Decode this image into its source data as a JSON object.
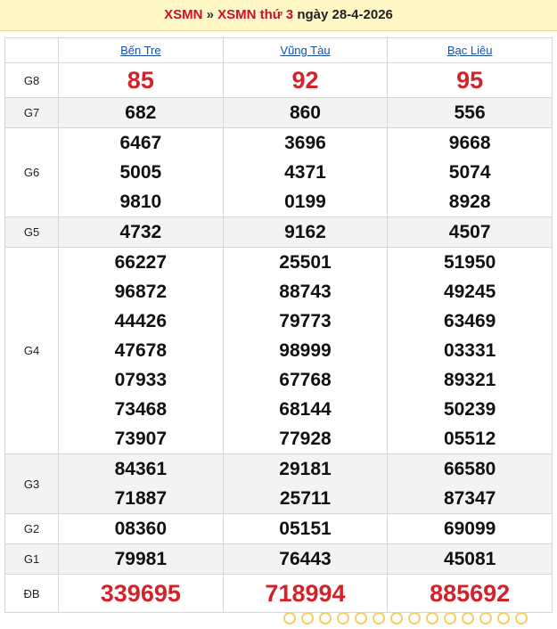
{
  "breadcrumb": {
    "link1": "XSMN",
    "separator": "»",
    "link2": "XSMN thứ 3",
    "date_text": "ngày 28-4-2026"
  },
  "provinces": [
    "Bến Tre",
    "Vũng Tàu",
    "Bạc Liêu"
  ],
  "prizes": [
    {
      "label": "G8",
      "values": [
        [
          "85"
        ],
        [
          "92"
        ],
        [
          "95"
        ]
      ]
    },
    {
      "label": "G7",
      "values": [
        [
          "682"
        ],
        [
          "860"
        ],
        [
          "556"
        ]
      ]
    },
    {
      "label": "G6",
      "values": [
        [
          "6467",
          "5005",
          "9810"
        ],
        [
          "3696",
          "4371",
          "0199"
        ],
        [
          "9668",
          "5074",
          "8928"
        ]
      ]
    },
    {
      "label": "G5",
      "values": [
        [
          "4732"
        ],
        [
          "9162"
        ],
        [
          "4507"
        ]
      ]
    },
    {
      "label": "G4",
      "values": [
        [
          "66227",
          "96872",
          "44426",
          "47678",
          "07933",
          "73468",
          "73907"
        ],
        [
          "25501",
          "88743",
          "79773",
          "98999",
          "67768",
          "68144",
          "77928"
        ],
        [
          "51950",
          "49245",
          "63469",
          "03331",
          "89321",
          "50239",
          "05512"
        ]
      ]
    },
    {
      "label": "G3",
      "values": [
        [
          "84361",
          "71887"
        ],
        [
          "29181",
          "25711"
        ],
        [
          "66580",
          "87347"
        ]
      ]
    },
    {
      "label": "G2",
      "values": [
        [
          "08360"
        ],
        [
          "05151"
        ],
        [
          "69099"
        ]
      ]
    },
    {
      "label": "G1",
      "values": [
        [
          "79981"
        ],
        [
          "76443"
        ],
        [
          "45081"
        ]
      ]
    },
    {
      "label": "ĐB",
      "values": [
        [
          "339695"
        ],
        [
          "718994"
        ],
        [
          "885692"
        ]
      ]
    }
  ],
  "colors": {
    "accent_red": "#d2232a",
    "link_blue": "#1a4fa0",
    "header_bg": "#fff7c6"
  }
}
